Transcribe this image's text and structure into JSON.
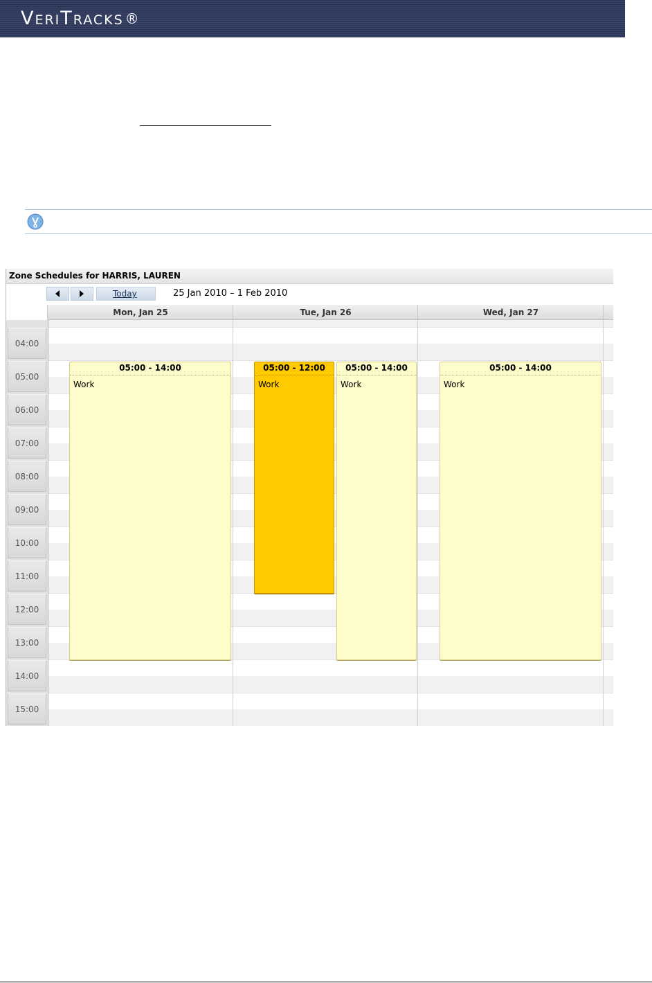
{
  "brand": {
    "name": "VeriTracks",
    "reg_mark": "®"
  },
  "calendar": {
    "title": "Zone Schedules for HARRIS, LAUREN",
    "toolbar": {
      "prev_icon": "triangle-left-icon",
      "next_icon": "triangle-right-icon",
      "today_label": "Today",
      "date_range": "25 Jan 2010 – 1 Feb 2010"
    },
    "days": [
      "Mon, Jan 25",
      "Tue, Jan 26",
      "Wed, Jan 27"
    ],
    "times": [
      "04:00",
      "05:00",
      "06:00",
      "07:00",
      "08:00",
      "09:00",
      "10:00",
      "11:00",
      "12:00",
      "13:00",
      "14:00",
      "15:00"
    ],
    "events": [
      {
        "time": "05:00 - 14:00",
        "label": "Work",
        "day": "Mon, Jan 25"
      },
      {
        "time": "05:00 - 12:00",
        "label": "Work",
        "day": "Tue, Jan 26",
        "selected": true
      },
      {
        "time": "05:00 - 14:00",
        "label": "Work",
        "day": "Tue, Jan 26"
      },
      {
        "time": "05:00 - 14:00",
        "label": "Work",
        "day": "Wed, Jan 27"
      }
    ],
    "colors": {
      "event": "#fefcca",
      "selected_event": "#ffca00",
      "banner": "#2f3a5c"
    }
  },
  "note": {
    "icon": "lightbulb-icon"
  }
}
